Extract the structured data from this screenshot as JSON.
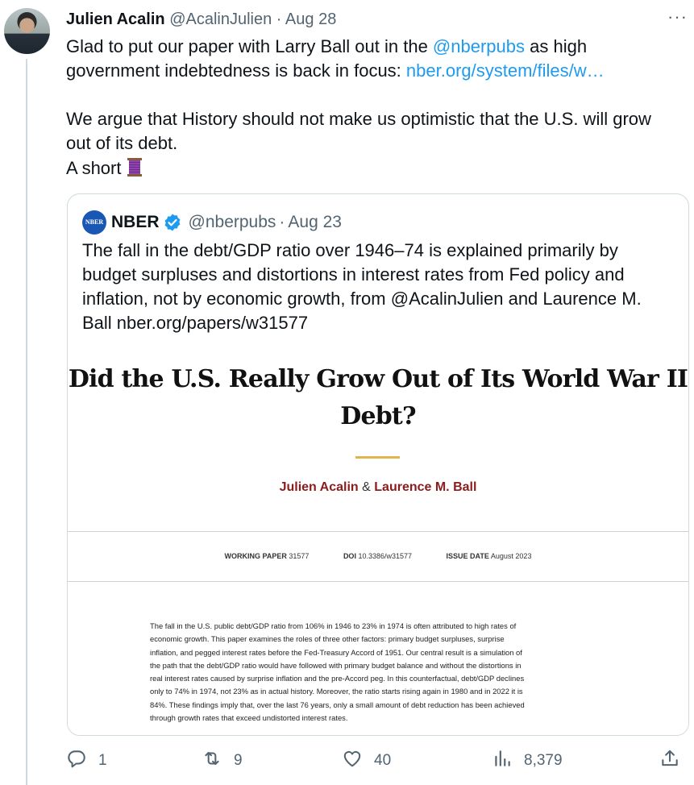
{
  "author": {
    "name": "Julien Acalin",
    "handle": "@AcalinJulien",
    "separator": "·",
    "date": "Aug 28"
  },
  "more_label": "···",
  "tweet": {
    "line1_pre": "Glad to put our paper with Larry Ball out in the ",
    "line1_mention": "@nberpubs",
    "line1_post": " as high",
    "line2_pre": "government indebtedness is back in focus: ",
    "line2_link": "nber.org/system/files/w…",
    "line3": "We argue that History should not make us optimistic that the U.S. will grow",
    "line4": "out of its debt.",
    "line5": "A short "
  },
  "quote": {
    "logo_text": "NBER",
    "name": "NBER",
    "handle": "@nberpubs",
    "separator": "·",
    "date": "Aug 23",
    "lines": [
      "The fall in the debt/GDP ratio over 1946–74 is explained primarily by",
      "budget surpluses and distortions in interest rates from Fed policy and",
      "inflation, not by economic growth, from @AcalinJulien and Laurence M.",
      "Ball nber.org/papers/w31577"
    ]
  },
  "paper": {
    "title_line1": "Did the U.S. Really Grow Out of Its World War II",
    "title_line2": "Debt?",
    "author1": "Julien Acalin",
    "amp": "&",
    "author2": "Laurence M. Ball",
    "wp_label": "WORKING PAPER",
    "wp_value": "31577",
    "doi_label": "DOI",
    "doi_value": "10.3386/w31577",
    "issue_label": "ISSUE DATE",
    "issue_value": "August 2023",
    "abstract_lines": [
      "The fall in the U.S. public debt/GDP ratio from 106% in 1946 to 23% in 1974 is often attributed to high rates of",
      "economic growth. This paper examines the roles of three other factors: primary budget surpluses, surprise",
      "inflation, and pegged interest rates before the Fed-Treasury Accord of 1951. Our central result is a simulation of",
      "the path that the debt/GDP ratio would have followed with primary budget balance and without the distortions in",
      "real interest rates caused by surprise inflation and the pre-Accord peg. In this counterfactual, debt/GDP declines",
      "only to 74% in 1974, not 23% as in actual history. Moreover, the ratio starts rising again in 1980 and in 2022 it is",
      "84%. These findings imply that, over the last 76 years, only a small amount of debt reduction has been achieved",
      "through growth rates that exceed undistorted interest rates."
    ]
  },
  "actions": {
    "replies": "1",
    "retweets": "9",
    "likes": "40",
    "views": "8,379"
  },
  "colors": {
    "link": "#1d9bf0",
    "muted": "#536471",
    "author_red": "#8b1c1c",
    "gold": "#e0b54a",
    "verified": "#1d9bf0"
  },
  "icons": [
    "reply-icon",
    "retweet-icon",
    "like-icon",
    "views-icon",
    "share-icon",
    "verified-icon",
    "spool-emoji"
  ]
}
